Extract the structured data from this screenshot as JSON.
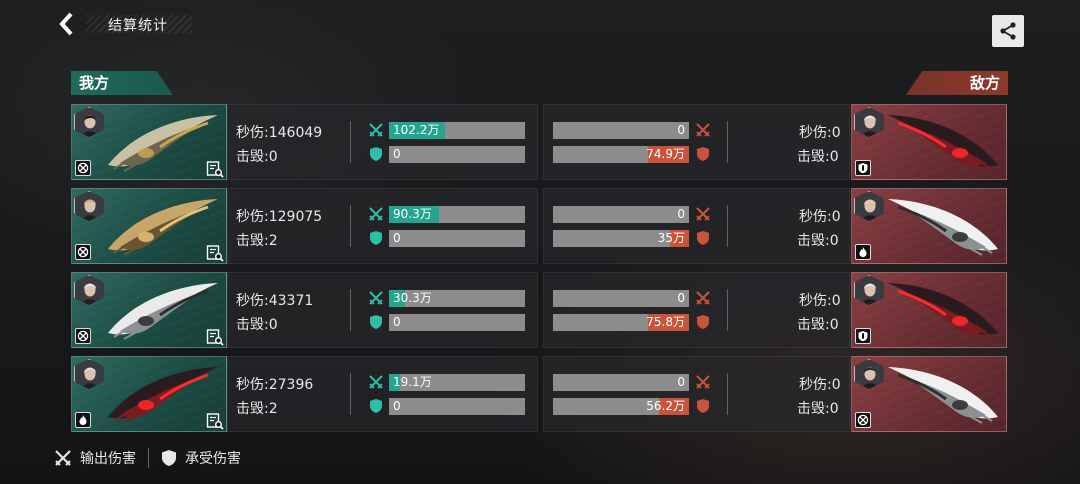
{
  "header": {
    "title": "结算统计",
    "back_icon": "chevron-left-icon",
    "share_icon": "share-icon"
  },
  "sides": {
    "ours_label": "我方",
    "enemy_label": "敌方",
    "ours_color": "#1f6b5c",
    "enemy_color": "#8c3a2c"
  },
  "labels": {
    "dps": "秒伤:",
    "kills": "击毁:"
  },
  "rows": [
    {
      "ours": {
        "dps": "146049",
        "kills": "0",
        "dealt": "102.2万",
        "dealt_fill": 0.41,
        "taken": "0",
        "taken_fill": 0,
        "class_icon": "target-icon"
      },
      "enemy": {
        "dps": "0",
        "kills": "0",
        "dealt": "0",
        "dealt_fill": 0,
        "taken": "74.9万",
        "taken_fill": 0.3,
        "class_icon": "shield-class-icon"
      }
    },
    {
      "ours": {
        "dps": "129075",
        "kills": "2",
        "dealt": "90.3万",
        "dealt_fill": 0.37,
        "taken": "0",
        "taken_fill": 0,
        "class_icon": "target-icon"
      },
      "enemy": {
        "dps": "0",
        "kills": "0",
        "dealt": "0",
        "dealt_fill": 0,
        "taken": "35万",
        "taken_fill": 0.14,
        "class_icon": "flame-class-icon"
      }
    },
    {
      "ours": {
        "dps": "43371",
        "kills": "0",
        "dealt": "30.3万",
        "dealt_fill": 0.12,
        "taken": "0",
        "taken_fill": 0,
        "class_icon": "target-icon"
      },
      "enemy": {
        "dps": "0",
        "kills": "0",
        "dealt": "0",
        "dealt_fill": 0,
        "taken": "75.8万",
        "taken_fill": 0.3,
        "class_icon": "shield-class-icon"
      }
    },
    {
      "ours": {
        "dps": "27396",
        "kills": "2",
        "dealt": "19.1万",
        "dealt_fill": 0.08,
        "taken": "0",
        "taken_fill": 0,
        "class_icon": "flame-class-icon"
      },
      "enemy": {
        "dps": "0",
        "kills": "0",
        "dealt": "0",
        "dealt_fill": 0,
        "taken": "56.2万",
        "taken_fill": 0.22,
        "class_icon": "target-icon"
      }
    }
  ],
  "legend": {
    "dealt_label": "输出伤害",
    "taken_label": "承受伤害"
  }
}
